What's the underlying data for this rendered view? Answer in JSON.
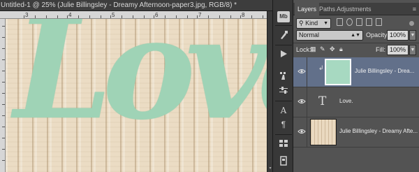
{
  "document": {
    "tab_title": "Untitled-1 @ 25% (Julie Billingsley - Dreamy Afternoon-paper3.jpg, RGB/8) *",
    "ruler_numbers": [
      "3",
      "4",
      "5",
      "6",
      "7",
      "8"
    ],
    "canvas_text": "Love"
  },
  "toolstrip": {
    "mb_label": "Mb",
    "a_label": "A",
    "para_label": "¶"
  },
  "layers_panel": {
    "tabs": [
      "Layers",
      "Paths",
      "Adjustments"
    ],
    "menu_icon": "≡",
    "filter_kind": "Kind",
    "blend_mode": "Normal",
    "opacity_label": "Opacity:",
    "opacity_value": "100%",
    "lock_label": "Lock:",
    "fill_label": "Fill:",
    "fill_value": "100%",
    "layers": [
      {
        "name": "Julie Billingsley - Drea...",
        "selected": true,
        "kind": "image-clipped"
      },
      {
        "name": "Love.",
        "selected": false,
        "kind": "type"
      },
      {
        "name": "Julie Billingsley - Dreamy Afte...",
        "selected": false,
        "kind": "image"
      }
    ]
  },
  "colors": {
    "love_text": "#9fd3b6",
    "wood": "#ebdcc4",
    "selected_layer": "#62708a",
    "panel_bg": "#535353"
  }
}
